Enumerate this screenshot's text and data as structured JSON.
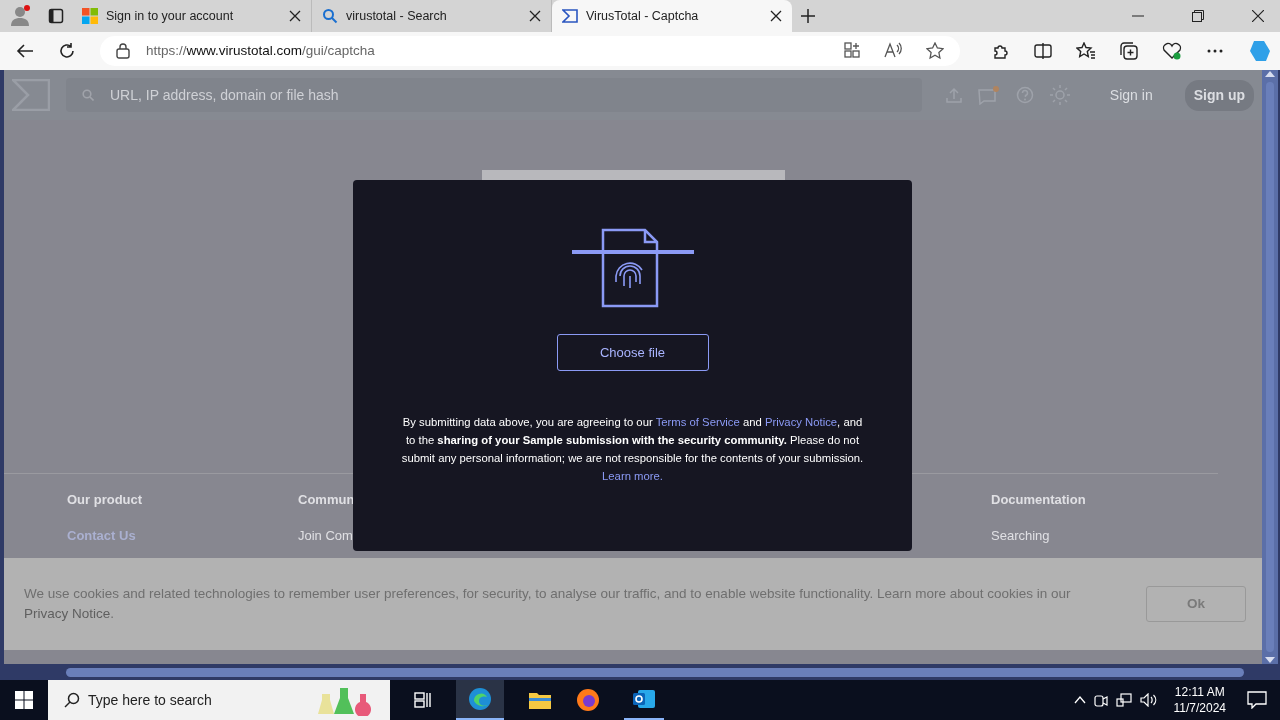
{
  "browser": {
    "tabs": [
      {
        "title": "Sign in to your account",
        "selected": false
      },
      {
        "title": "virustotal - Search",
        "selected": false
      },
      {
        "title": "VirusTotal - Captcha",
        "selected": true
      }
    ],
    "url_scheme": "https://",
    "url_host": "www.virustotal.com",
    "url_path": "/gui/captcha"
  },
  "site_header": {
    "search_placeholder": "URL, IP address, domain or file hash",
    "sign_in": "Sign in",
    "sign_up": "Sign up"
  },
  "footer": {
    "columns": [
      {
        "heading": "Our product",
        "links": [
          {
            "label": "Contact Us",
            "highlighted": true
          }
        ]
      },
      {
        "heading": "Commun",
        "links": [
          {
            "label": "Join Com",
            "highlighted": false
          }
        ]
      },
      {
        "heading": "Documentation",
        "links": [
          {
            "label": "Searching",
            "highlighted": false
          }
        ]
      }
    ]
  },
  "modal": {
    "button": "Choose file",
    "notice": [
      {
        "kind": "plain",
        "text": "By submitting data above, you are agreeing to our "
      },
      {
        "kind": "link",
        "text": "Terms of Service"
      },
      {
        "kind": "plain",
        "text": " and "
      },
      {
        "kind": "link",
        "text": "Privacy Notice"
      },
      {
        "kind": "plain",
        "text": ", and to the "
      },
      {
        "kind": "bold",
        "text": "sharing of your Sample submission with the security community."
      },
      {
        "kind": "plain",
        "text": " Please do not submit any personal information; we are not responsible for the contents of your submission. "
      },
      {
        "kind": "link",
        "text": "Learn more."
      }
    ]
  },
  "cookie_banner": {
    "text": "We use cookies and related technologies to remember user preferences, for security, to analyse our traffic, and to enable website functionality. Learn more about cookies in our ",
    "link": "Privacy Notice",
    "after": ".",
    "button": "Ok"
  },
  "taskbar": {
    "search_placeholder": "Type here to search",
    "time": "12:11 AM",
    "date": "11/7/2024"
  }
}
